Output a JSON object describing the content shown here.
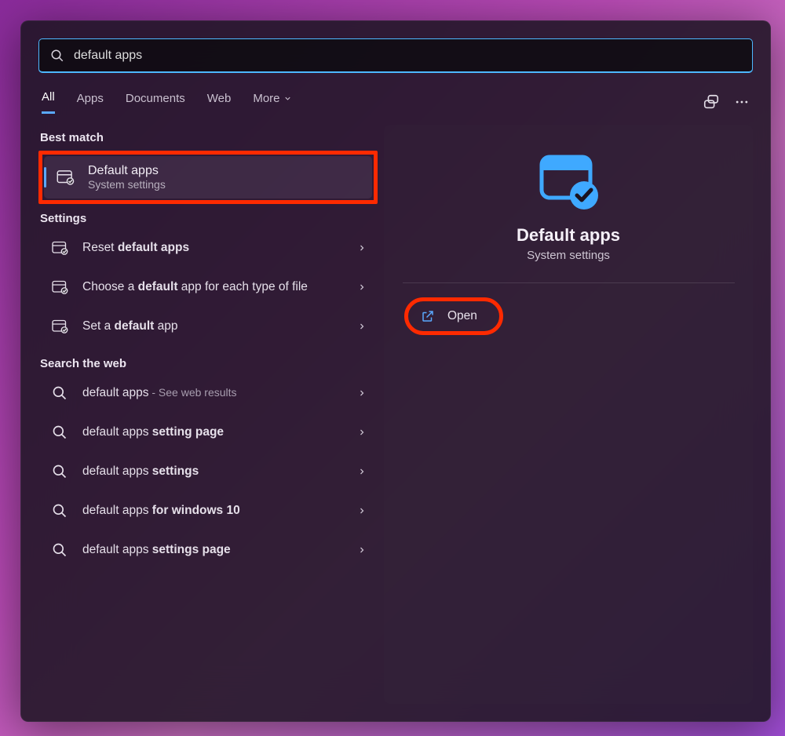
{
  "search": {
    "value": "default apps"
  },
  "tabs": {
    "all": "All",
    "apps": "Apps",
    "documents": "Documents",
    "web": "Web",
    "more": "More"
  },
  "sections": {
    "best_match": "Best match",
    "settings": "Settings",
    "web": "Search the web"
  },
  "best_match_item": {
    "title": "Default apps",
    "subtitle": "System settings"
  },
  "settings_items": [
    {
      "prefix": "Reset ",
      "bold": "default apps",
      "suffix": ""
    },
    {
      "prefix": "Choose a ",
      "bold": "default",
      "suffix": " app for each type of file"
    },
    {
      "prefix": "Set a ",
      "bold": "default",
      "suffix": " app"
    }
  ],
  "web_items": [
    {
      "prefix": "default apps",
      "bold": "",
      "suffix": "",
      "extra": " - See web results"
    },
    {
      "prefix": "default apps ",
      "bold": "setting page",
      "suffix": "",
      "extra": ""
    },
    {
      "prefix": "default apps ",
      "bold": "settings",
      "suffix": "",
      "extra": ""
    },
    {
      "prefix": "default apps ",
      "bold": "for windows 10",
      "suffix": "",
      "extra": ""
    },
    {
      "prefix": "default apps ",
      "bold": "settings page",
      "suffix": "",
      "extra": ""
    }
  ],
  "details": {
    "title": "Default apps",
    "subtitle": "System settings",
    "open": "Open"
  }
}
